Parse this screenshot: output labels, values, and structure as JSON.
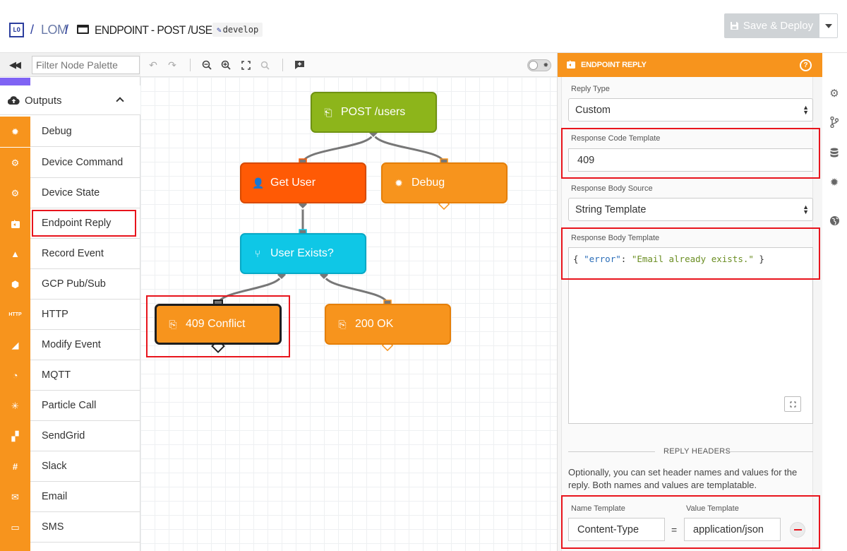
{
  "header": {
    "logo_text": "LO",
    "separator": "/",
    "app_name": "LOM",
    "workflow_title": "ENDPOINT - POST /USERS",
    "branch": "develop",
    "save_label": "Save & Deploy"
  },
  "palette": {
    "filter_placeholder": "Filter Node Palette",
    "category": "Outputs",
    "items": [
      {
        "label": "Debug",
        "icon": "bug-icon"
      },
      {
        "label": "Device Command",
        "icon": "chip-command-icon"
      },
      {
        "label": "Device State",
        "icon": "chip-state-icon"
      },
      {
        "label": "Endpoint Reply",
        "icon": "reply-icon"
      },
      {
        "label": "Record Event",
        "icon": "event-add-icon"
      },
      {
        "label": "GCP Pub/Sub",
        "icon": "gcp-icon"
      },
      {
        "label": "HTTP",
        "icon": "http-icon"
      },
      {
        "label": "Modify Event",
        "icon": "event-edit-icon"
      },
      {
        "label": "MQTT",
        "icon": "mqtt-icon"
      },
      {
        "label": "Particle Call",
        "icon": "particle-icon"
      },
      {
        "label": "SendGrid",
        "icon": "sendgrid-icon"
      },
      {
        "label": "Slack",
        "icon": "slack-icon"
      },
      {
        "label": "Email",
        "icon": "email-icon"
      },
      {
        "label": "SMS",
        "icon": "sms-icon"
      }
    ],
    "http_icon_text": "HTTP"
  },
  "canvas": {
    "nodes": [
      {
        "label": "POST /users",
        "color": "#8db51b"
      },
      {
        "label": "Get User",
        "color": "#ff5a05"
      },
      {
        "label": "Debug",
        "color": "#f7941d"
      },
      {
        "label": "User Exists?",
        "color": "#0fc7e6"
      },
      {
        "label": "409 Conflict",
        "color": "#f7941d"
      },
      {
        "label": "200 OK",
        "color": "#f7941d"
      }
    ]
  },
  "inspector": {
    "title": "ENDPOINT REPLY",
    "reply_type_label": "Reply Type",
    "reply_type_value": "Custom",
    "response_code_label": "Response Code Template",
    "response_code_value": "409",
    "body_source_label": "Response Body Source",
    "body_source_value": "String Template",
    "body_template_label": "Response Body Template",
    "body_code": {
      "open": "{ ",
      "key": "\"error\"",
      "colon": ": ",
      "value": "\"Email already exists.\"",
      "close": " }"
    },
    "reply_headers_title": "REPLY HEADERS",
    "reply_headers_help": "Optionally, you can set header names and values for the reply. Both names and values are templatable.",
    "name_template_label": "Name Template",
    "value_template_label": "Value Template",
    "header_name": "Content-Type",
    "equals": "=",
    "header_value": "application/json"
  },
  "colors": {
    "accent_orange": "#f7941d",
    "highlight_red": "#e8141c",
    "brand_blue": "#2c3e9e"
  }
}
